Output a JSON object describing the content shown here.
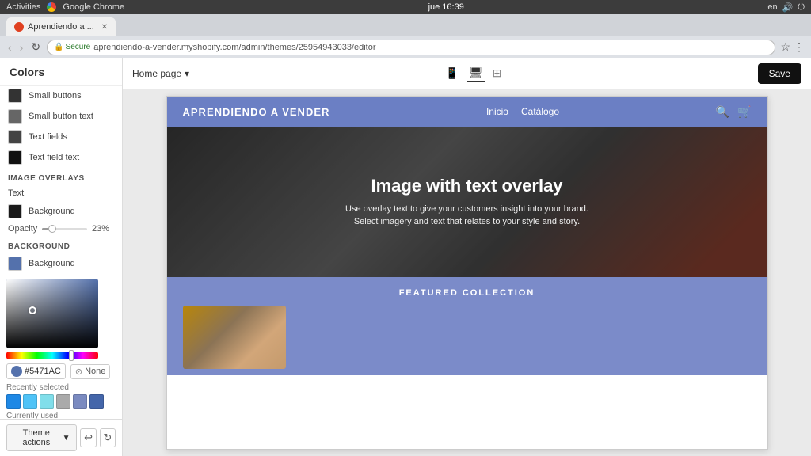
{
  "os_bar": {
    "activities": "Activities",
    "app_name": "Google Chrome",
    "time": "jue 16:39",
    "lang": "en"
  },
  "browser": {
    "tab_title": "Aprendiendo a ...",
    "address": "aprendiendo-a-vender.myshopify.com/admin/themes/25954943033/editor",
    "secure_text": "Secure"
  },
  "toolbar": {
    "home_page_label": "Home page",
    "save_label": "Save"
  },
  "sidebar": {
    "title": "Colors",
    "small_buttons_label": "Small buttons",
    "small_button_text_label": "Small button text",
    "text_fields_label": "Text fields",
    "text_field_text_label": "Text field text",
    "image_overlays_section": "IMAGE OVERLAYS",
    "text_label": "Text",
    "background_label": "Background",
    "opacity_label": "Opacity",
    "opacity_value": "23%",
    "background_section": "BACKGROUND",
    "background_sw_label": "Background",
    "hex_value": "#5471AC",
    "none_label": "None",
    "recently_selected": "Recently selected",
    "currently_used": "Currently used",
    "theme_actions_label": "Theme actions"
  },
  "site": {
    "logo": "APRENDIENDO A VENDER",
    "nav_inicio": "Inicio",
    "nav_catalogo": "Catálogo",
    "hero_title": "Image with text overlay",
    "hero_text1": "Use overlay text to give your customers insight into your brand.",
    "hero_text2": "Select imagery and text that relates to your style and story.",
    "featured_title": "FEATURED COLLECTION"
  },
  "colors": {
    "small_buttons": "#333333",
    "small_button_text": "#666666",
    "text_fields": "#444444",
    "text_field_text": "#111111",
    "overlay_text": "#ffffff",
    "overlay_background": "#1a1a1a",
    "bg_swatch": "#5471AC",
    "recently": [
      "#1e88e5",
      "#4fc3f7",
      "#80deea",
      "#aaaaaa",
      "#888888",
      "#4466aa"
    ],
    "currently": [
      "#555555",
      "#666666",
      "#5471AC",
      "#888888",
      "#aaaaaa",
      "#111111",
      "#222222",
      "#cc2222",
      "#ee4444",
      "#333333",
      "#5588cc"
    ]
  }
}
